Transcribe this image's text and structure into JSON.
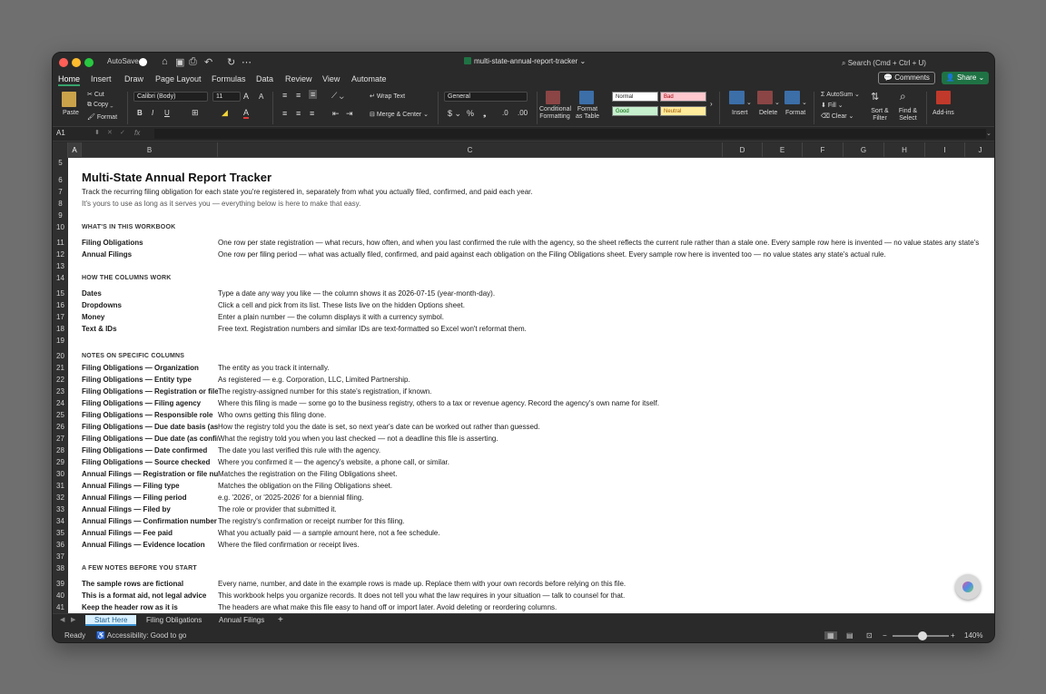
{
  "titlebar": {
    "autosave_label": "AutoSave",
    "doc_title": "multi-state-annual-report-tracker",
    "search_placeholder": "Search (Cmd + Ctrl + U)"
  },
  "menu_tabs": [
    "Home",
    "Insert",
    "Draw",
    "Page Layout",
    "Formulas",
    "Data",
    "Review",
    "View",
    "Automate"
  ],
  "buttons": {
    "comments": "Comments",
    "share": "Share"
  },
  "ribbon": {
    "paste": "Paste",
    "cut": "Cut",
    "copy": "Copy",
    "format": "Format",
    "font_name": "Calibri (Body)",
    "font_size": "11",
    "wrap_text": "Wrap Text",
    "merge_center": "Merge & Center",
    "number_format": "General",
    "conditional_formatting": "Conditional Formatting",
    "format_as_table": "Format as Table",
    "styles": {
      "normal": "Normal",
      "bad": "Bad",
      "good": "Good",
      "neutral": "Neutral"
    },
    "insert": "Insert",
    "delete": "Delete",
    "format_cells": "Format",
    "autosum": "AutoSum",
    "fill": "Fill",
    "clear": "Clear",
    "sort_filter": "Sort & Filter",
    "find_select": "Find & Select",
    "addins": "Add-ins"
  },
  "formula_bar": {
    "name_box": "A1",
    "fx": "fx"
  },
  "columns": [
    "A",
    "B",
    "C",
    "D",
    "E",
    "F",
    "G",
    "H",
    "I",
    "J"
  ],
  "rows": [
    {
      "n": "5",
      "b": "",
      "c": ""
    },
    {
      "n": "6",
      "type": "title",
      "text": "Multi-State Annual Report Tracker"
    },
    {
      "n": "7",
      "type": "sub",
      "text": "Track the recurring filing obligation for each state you're registered in, separately from what you actually filed, confirmed, and paid each year."
    },
    {
      "n": "8",
      "type": "sub2",
      "text": "It's yours to use as long as it serves you — everything below is here to make that easy."
    },
    {
      "n": "9",
      "b": "",
      "c": ""
    },
    {
      "n": "10",
      "type": "section",
      "text": "WHAT'S IN THIS WORKBOOK"
    },
    {
      "n": "11",
      "b": "Filing Obligations",
      "c": "One row per state registration — what recurs, how often, and when you last confirmed the rule with the agency, so the sheet reflects the current rule rather than a stale one. Every sample row here is invented — no value states any state's"
    },
    {
      "n": "12",
      "b": "Annual Filings",
      "c": "One row per filing period — what was actually filed, confirmed, and paid against each obligation on the Filing Obligations sheet. Every sample row here is invented too — no value states any state's actual rule."
    },
    {
      "n": "13",
      "b": "",
      "c": ""
    },
    {
      "n": "14",
      "type": "section",
      "text": "HOW THE COLUMNS WORK"
    },
    {
      "n": "15",
      "b": "Dates",
      "c": "Type a date any way you like — the column shows it as 2026-07-15 (year-month-day)."
    },
    {
      "n": "16",
      "b": "Dropdowns",
      "c": "Click a cell and pick from its list. These lists live on the hidden Options sheet."
    },
    {
      "n": "17",
      "b": "Money",
      "c": "Enter a plain number — the column displays it with a currency symbol."
    },
    {
      "n": "18",
      "b": "Text & IDs",
      "c": "Free text. Registration numbers and similar IDs are text-formatted so Excel won't reformat them."
    },
    {
      "n": "19",
      "b": "",
      "c": ""
    },
    {
      "n": "20",
      "type": "section",
      "text": "NOTES ON SPECIFIC COLUMNS"
    },
    {
      "n": "21",
      "b": "Filing Obligations — Organization",
      "c": "The entity as you track it internally."
    },
    {
      "n": "22",
      "b": "Filing Obligations — Entity type",
      "c": "As registered — e.g. Corporation, LLC, Limited Partnership."
    },
    {
      "n": "23",
      "b": "Filing Obligations — Registration or file n",
      "c": "The registry-assigned number for this state's registration, if known."
    },
    {
      "n": "24",
      "b": "Filing Obligations — Filing agency",
      "c": "Where this filing is made — some go to the business registry, others to a tax or revenue agency. Record the agency's own name for itself."
    },
    {
      "n": "25",
      "b": "Filing Obligations — Responsible role",
      "c": "Who owns getting this filing done."
    },
    {
      "n": "26",
      "b": "Filing Obligations — Due date basis (as c",
      "c": "How the registry told you the date is set, so next year's date can be worked out rather than guessed."
    },
    {
      "n": "27",
      "b": "Filing Obligations — Due date (as confirm",
      "c": "What the registry told you when you last checked — not a deadline this file is asserting."
    },
    {
      "n": "28",
      "b": "Filing Obligations — Date confirmed",
      "c": "The date you last verified this rule with the agency."
    },
    {
      "n": "29",
      "b": "Filing Obligations — Source checked",
      "c": "Where you confirmed it — the agency's website, a phone call, or similar."
    },
    {
      "n": "30",
      "b": "Annual Filings — Registration or file num",
      "c": "Matches the registration on the Filing Obligations sheet."
    },
    {
      "n": "31",
      "b": "Annual Filings — Filing type",
      "c": "Matches the obligation on the Filing Obligations sheet."
    },
    {
      "n": "32",
      "b": "Annual Filings — Filing period",
      "c": "e.g. '2026', or '2025-2026' for a biennial filing."
    },
    {
      "n": "33",
      "b": "Annual Filings — Filed by",
      "c": "The role or provider that submitted it."
    },
    {
      "n": "34",
      "b": "Annual Filings — Confirmation number",
      "c": "The registry's confirmation or receipt number for this filing."
    },
    {
      "n": "35",
      "b": "Annual Filings — Fee paid",
      "c": "What you actually paid — a sample amount here, not a fee schedule."
    },
    {
      "n": "36",
      "b": "Annual Filings — Evidence location",
      "c": "Where the filed confirmation or receipt lives."
    },
    {
      "n": "37",
      "b": "",
      "c": ""
    },
    {
      "n": "38",
      "type": "section",
      "text": "A FEW NOTES BEFORE YOU START"
    },
    {
      "n": "39",
      "b": "The sample rows are fictional",
      "c": "Every name, number, and date in the example rows is made up. Replace them with your own records before relying on this file."
    },
    {
      "n": "40",
      "b": "This is a format aid, not legal advice",
      "c": "This workbook helps you organize records. It does not tell you what the law requires in your situation — talk to counsel for that."
    },
    {
      "n": "41",
      "b": "Keep the header row as it is",
      "c": "The headers are what make this file easy to hand off or import later. Avoid deleting or reordering columns."
    },
    {
      "n": "42",
      "b": "",
      "c": ""
    }
  ],
  "sheet_tabs": [
    "Start Here",
    "Filing Obligations",
    "Annual Filings"
  ],
  "status": {
    "ready": "Ready",
    "accessibility": "Accessibility: Good to go",
    "zoom": "140%"
  }
}
